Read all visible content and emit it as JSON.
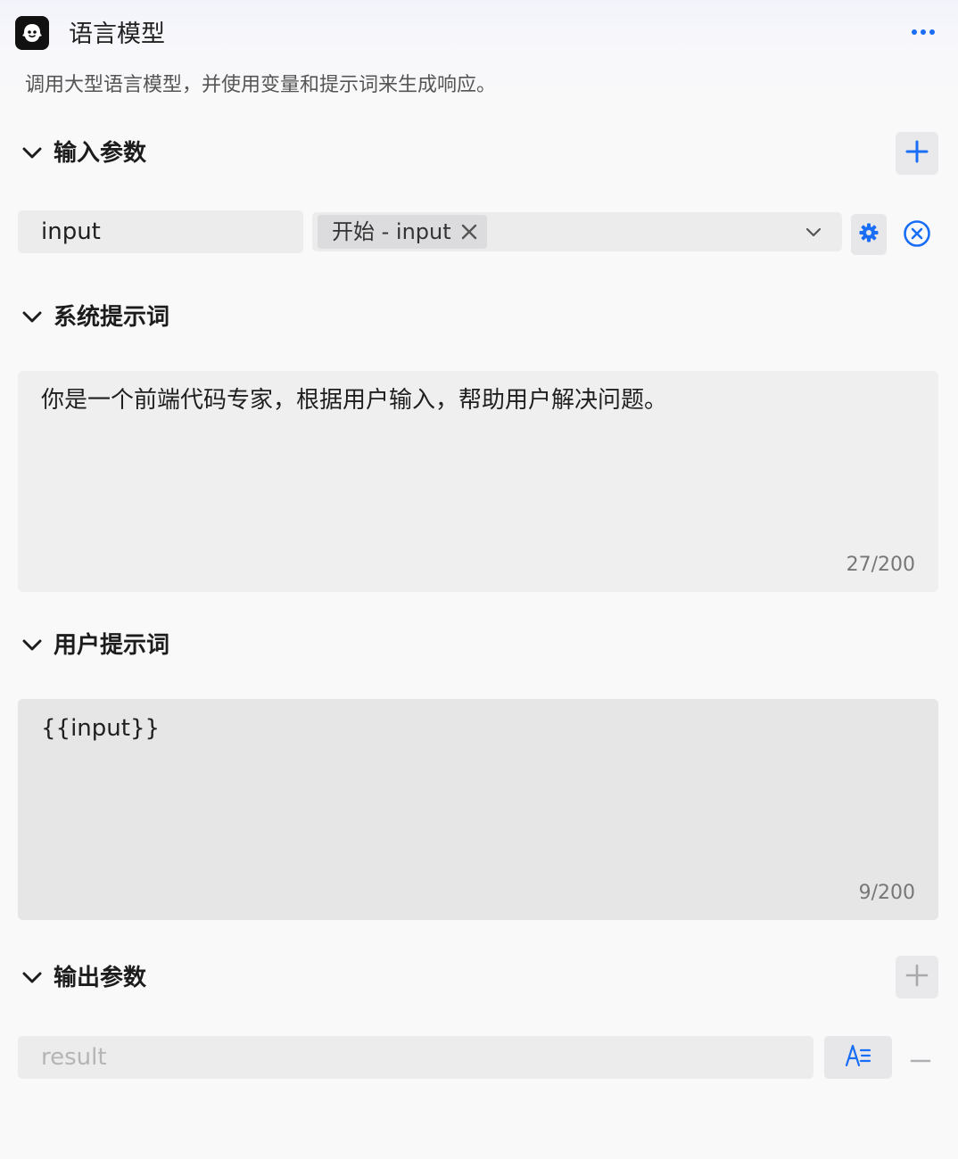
{
  "header": {
    "title": "语言模型",
    "description": "调用大型语言模型，并使用变量和提示词来生成响应。",
    "app_icon": "robot-icon",
    "more_icon": "ellipsis-icon"
  },
  "input_params": {
    "title": "输入参数",
    "items": [
      {
        "name": "input",
        "source_tag": "开始 - input"
      }
    ]
  },
  "system_prompt": {
    "title": "系统提示词",
    "text": "你是一个前端代码专家，根据用户输入，帮助用户解决问题。",
    "counter": "27/200"
  },
  "user_prompt": {
    "title": "用户提示词",
    "text": "{{input}}",
    "counter": "9/200"
  },
  "output_params": {
    "title": "输出参数",
    "items": [
      {
        "name_placeholder": "result"
      }
    ]
  },
  "colors": {
    "accent": "#1a6ef5",
    "muted": "#b0b0b3"
  }
}
